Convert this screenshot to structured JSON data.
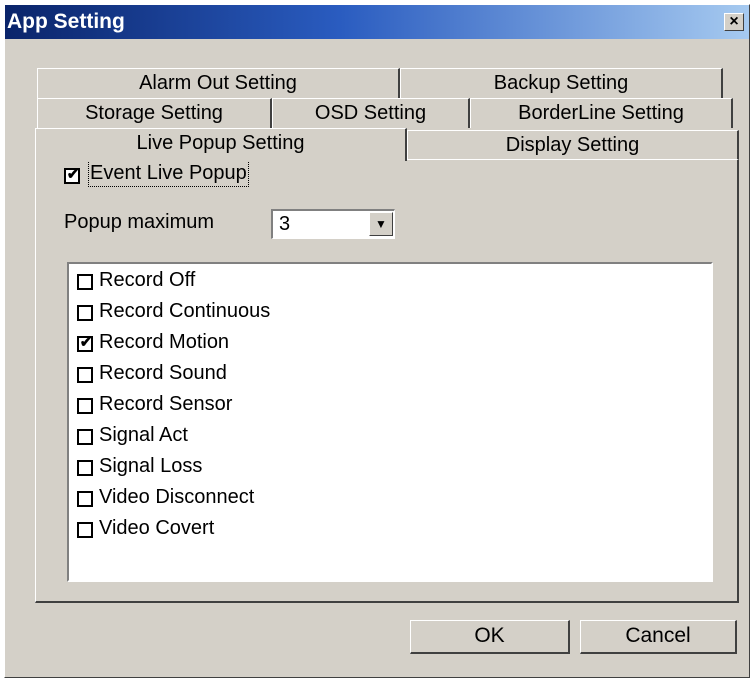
{
  "window": {
    "title": "App Setting",
    "close_label": "×"
  },
  "tabs": {
    "row1": [
      "Alarm Out Setting",
      "Backup Setting"
    ],
    "row2": [
      "Storage Setting",
      "OSD Setting",
      "BorderLine Setting"
    ],
    "row3": [
      "Live Popup Setting",
      "Display Setting"
    ],
    "active": "Live Popup Setting"
  },
  "panel": {
    "event_live_popup": {
      "label": "Event Live Popup",
      "checked": true
    },
    "popup_maximum": {
      "label": "Popup maximum",
      "value": "3",
      "arrow": "▼"
    },
    "events": [
      {
        "label": "Record Off",
        "checked": false
      },
      {
        "label": "Record Continuous",
        "checked": false
      },
      {
        "label": "Record Motion",
        "checked": true
      },
      {
        "label": "Record Sound",
        "checked": false
      },
      {
        "label": "Record Sensor",
        "checked": false
      },
      {
        "label": "Signal Act",
        "checked": false
      },
      {
        "label": "Signal Loss",
        "checked": false
      },
      {
        "label": "Video Disconnect",
        "checked": false
      },
      {
        "label": "Video Covert",
        "checked": false
      }
    ]
  },
  "buttons": {
    "ok": "OK",
    "cancel": "Cancel"
  },
  "check_glyph": "✔"
}
